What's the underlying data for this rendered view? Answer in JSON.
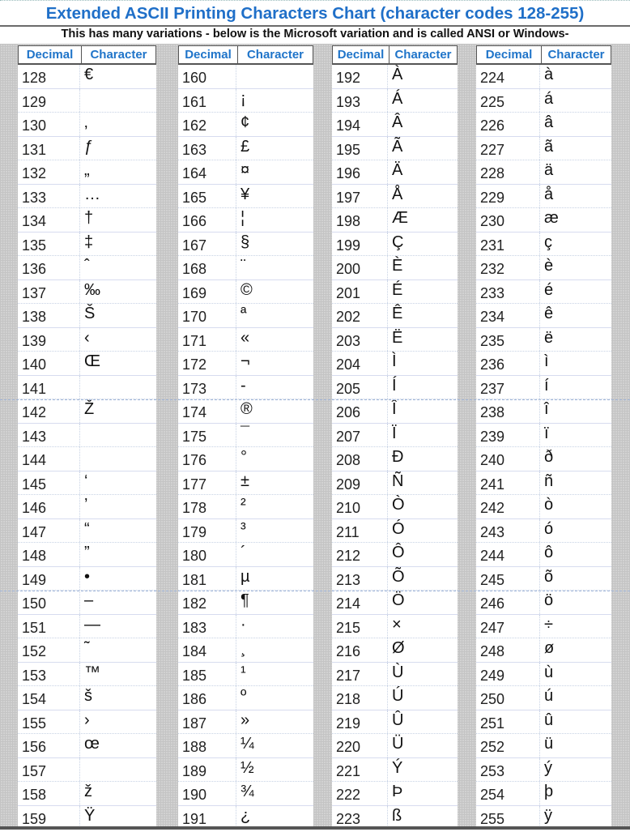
{
  "header": {
    "title": "Extended ASCII Printing Characters Chart (character codes 128-255)",
    "subtitle": "This has many variations - below is the Microsoft variation and is called ANSI or Windows-"
  },
  "columns": {
    "decimal_label": "Decimal",
    "character_label": "Character"
  },
  "colors": {
    "title": "#1f6fc8",
    "header_text": "#1f74c9",
    "gap_gray": "#d2d2d2"
  },
  "blocks": [
    {
      "rows": [
        {
          "dec": "128",
          "chr": "€"
        },
        {
          "dec": "129",
          "chr": ""
        },
        {
          "dec": "130",
          "chr": "‚"
        },
        {
          "dec": "131",
          "chr": "ƒ"
        },
        {
          "dec": "132",
          "chr": "„"
        },
        {
          "dec": "133",
          "chr": "…"
        },
        {
          "dec": "134",
          "chr": "†"
        },
        {
          "dec": "135",
          "chr": "‡"
        },
        {
          "dec": "136",
          "chr": "ˆ"
        },
        {
          "dec": "137",
          "chr": "‰"
        },
        {
          "dec": "138",
          "chr": "Š"
        },
        {
          "dec": "139",
          "chr": "‹"
        },
        {
          "dec": "140",
          "chr": "Œ"
        },
        {
          "dec": "141",
          "chr": ""
        },
        {
          "dec": "142",
          "chr": "Ž"
        },
        {
          "dec": "143",
          "chr": ""
        },
        {
          "dec": "144",
          "chr": ""
        },
        {
          "dec": "145",
          "chr": "‘"
        },
        {
          "dec": "146",
          "chr": "’"
        },
        {
          "dec": "147",
          "chr": "“"
        },
        {
          "dec": "148",
          "chr": "”"
        },
        {
          "dec": "149",
          "chr": "•"
        },
        {
          "dec": "150",
          "chr": "–"
        },
        {
          "dec": "151",
          "chr": "—"
        },
        {
          "dec": "152",
          "chr": "˜"
        },
        {
          "dec": "153",
          "chr": "™"
        },
        {
          "dec": "154",
          "chr": "š"
        },
        {
          "dec": "155",
          "chr": "›"
        },
        {
          "dec": "156",
          "chr": "œ"
        },
        {
          "dec": "157",
          "chr": ""
        },
        {
          "dec": "158",
          "chr": "ž"
        },
        {
          "dec": "159",
          "chr": "Ÿ"
        }
      ]
    },
    {
      "rows": [
        {
          "dec": "160",
          "chr": ""
        },
        {
          "dec": "161",
          "chr": "¡"
        },
        {
          "dec": "162",
          "chr": "¢"
        },
        {
          "dec": "163",
          "chr": "£"
        },
        {
          "dec": "164",
          "chr": "¤"
        },
        {
          "dec": "165",
          "chr": "¥"
        },
        {
          "dec": "166",
          "chr": "¦"
        },
        {
          "dec": "167",
          "chr": "§"
        },
        {
          "dec": "168",
          "chr": "¨"
        },
        {
          "dec": "169",
          "chr": "©"
        },
        {
          "dec": "170",
          "chr": "ª"
        },
        {
          "dec": "171",
          "chr": "«"
        },
        {
          "dec": "172",
          "chr": "¬"
        },
        {
          "dec": "173",
          "chr": "-"
        },
        {
          "dec": "174",
          "chr": "®"
        },
        {
          "dec": "175",
          "chr": "¯"
        },
        {
          "dec": "176",
          "chr": "°"
        },
        {
          "dec": "177",
          "chr": "±"
        },
        {
          "dec": "178",
          "chr": "²"
        },
        {
          "dec": "179",
          "chr": "³"
        },
        {
          "dec": "180",
          "chr": "´"
        },
        {
          "dec": "181",
          "chr": "µ"
        },
        {
          "dec": "182",
          "chr": "¶"
        },
        {
          "dec": "183",
          "chr": "·"
        },
        {
          "dec": "184",
          "chr": "¸"
        },
        {
          "dec": "185",
          "chr": "¹"
        },
        {
          "dec": "186",
          "chr": "º"
        },
        {
          "dec": "187",
          "chr": "»"
        },
        {
          "dec": "188",
          "chr": "¼"
        },
        {
          "dec": "189",
          "chr": "½"
        },
        {
          "dec": "190",
          "chr": "¾"
        },
        {
          "dec": "191",
          "chr": "¿"
        }
      ]
    },
    {
      "rows": [
        {
          "dec": "192",
          "chr": "À"
        },
        {
          "dec": "193",
          "chr": "Á"
        },
        {
          "dec": "194",
          "chr": "Â"
        },
        {
          "dec": "195",
          "chr": "Ã"
        },
        {
          "dec": "196",
          "chr": "Ä"
        },
        {
          "dec": "197",
          "chr": "Å"
        },
        {
          "dec": "198",
          "chr": "Æ"
        },
        {
          "dec": "199",
          "chr": "Ç"
        },
        {
          "dec": "200",
          "chr": "È"
        },
        {
          "dec": "201",
          "chr": "É"
        },
        {
          "dec": "202",
          "chr": "Ê"
        },
        {
          "dec": "203",
          "chr": "Ë"
        },
        {
          "dec": "204",
          "chr": "Ì"
        },
        {
          "dec": "205",
          "chr": "Í"
        },
        {
          "dec": "206",
          "chr": "Î"
        },
        {
          "dec": "207",
          "chr": "Ï"
        },
        {
          "dec": "208",
          "chr": "Ð"
        },
        {
          "dec": "209",
          "chr": "Ñ"
        },
        {
          "dec": "210",
          "chr": "Ò"
        },
        {
          "dec": "211",
          "chr": "Ó"
        },
        {
          "dec": "212",
          "chr": "Ô"
        },
        {
          "dec": "213",
          "chr": "Õ"
        },
        {
          "dec": "214",
          "chr": "Ö"
        },
        {
          "dec": "215",
          "chr": "×"
        },
        {
          "dec": "216",
          "chr": "Ø"
        },
        {
          "dec": "217",
          "chr": "Ù"
        },
        {
          "dec": "218",
          "chr": "Ú"
        },
        {
          "dec": "219",
          "chr": "Û"
        },
        {
          "dec": "220",
          "chr": "Ü"
        },
        {
          "dec": "221",
          "chr": "Ý"
        },
        {
          "dec": "222",
          "chr": "Þ"
        },
        {
          "dec": "223",
          "chr": "ß"
        }
      ]
    },
    {
      "rows": [
        {
          "dec": "224",
          "chr": "à"
        },
        {
          "dec": "225",
          "chr": "á"
        },
        {
          "dec": "226",
          "chr": "â"
        },
        {
          "dec": "227",
          "chr": "ã"
        },
        {
          "dec": "228",
          "chr": "ä"
        },
        {
          "dec": "229",
          "chr": "å"
        },
        {
          "dec": "230",
          "chr": "æ"
        },
        {
          "dec": "231",
          "chr": "ç"
        },
        {
          "dec": "232",
          "chr": "è"
        },
        {
          "dec": "233",
          "chr": "é"
        },
        {
          "dec": "234",
          "chr": "ê"
        },
        {
          "dec": "235",
          "chr": "ë"
        },
        {
          "dec": "236",
          "chr": "ì"
        },
        {
          "dec": "237",
          "chr": "í"
        },
        {
          "dec": "238",
          "chr": "î"
        },
        {
          "dec": "239",
          "chr": "ï"
        },
        {
          "dec": "240",
          "chr": "ð"
        },
        {
          "dec": "241",
          "chr": "ñ"
        },
        {
          "dec": "242",
          "chr": "ò"
        },
        {
          "dec": "243",
          "chr": "ó"
        },
        {
          "dec": "244",
          "chr": "ô"
        },
        {
          "dec": "245",
          "chr": "õ"
        },
        {
          "dec": "246",
          "chr": "ö"
        },
        {
          "dec": "247",
          "chr": "÷"
        },
        {
          "dec": "248",
          "chr": "ø"
        },
        {
          "dec": "249",
          "chr": "ù"
        },
        {
          "dec": "250",
          "chr": "ú"
        },
        {
          "dec": "251",
          "chr": "û"
        },
        {
          "dec": "252",
          "chr": "ü"
        },
        {
          "dec": "253",
          "chr": "ý"
        },
        {
          "dec": "254",
          "chr": "þ"
        },
        {
          "dec": "255",
          "chr": "ÿ"
        }
      ]
    }
  ]
}
